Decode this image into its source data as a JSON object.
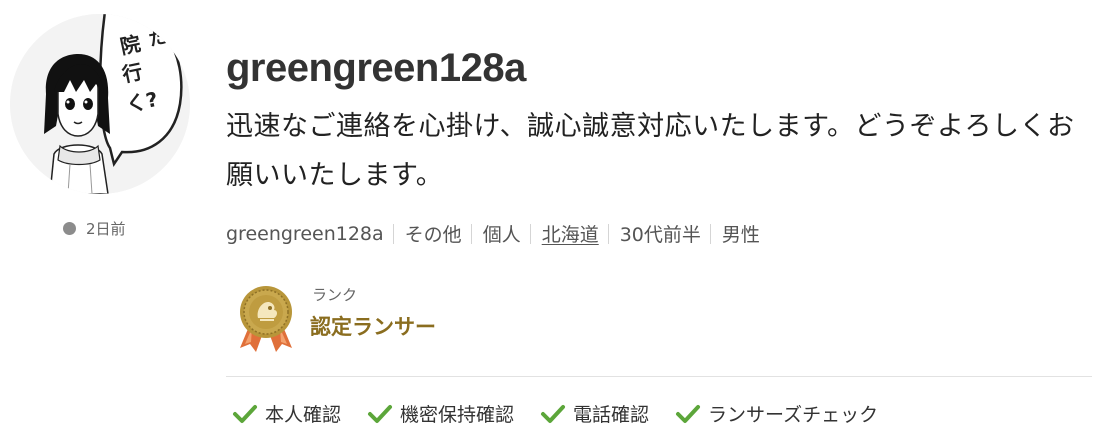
{
  "profile": {
    "username": "greengreen128a",
    "catchphrase": "迅速なご連絡を心掛け、誠心誠意対応いたします。どうぞよろしくお願いいたします。",
    "last_login": "2日前",
    "avatar_speech_text": "…ため 病院 行く?"
  },
  "meta": {
    "id": "greengreen128a",
    "category": "その他",
    "type": "個人",
    "region": "北海道",
    "age": "30代前半",
    "gender": "男性"
  },
  "rank": {
    "label": "ランク",
    "name": "認定ランサー"
  },
  "verifications": [
    {
      "label": "本人確認",
      "icon": "check-icon"
    },
    {
      "label": "機密保持確認",
      "icon": "check-icon"
    },
    {
      "label": "電話確認",
      "icon": "check-icon"
    },
    {
      "label": "ランサーズチェック",
      "icon": "check-icon"
    }
  ],
  "colors": {
    "rank_gold": "#8a6d1f",
    "check_green": "#5ca63a",
    "ribbon_red": "#e0703a"
  }
}
